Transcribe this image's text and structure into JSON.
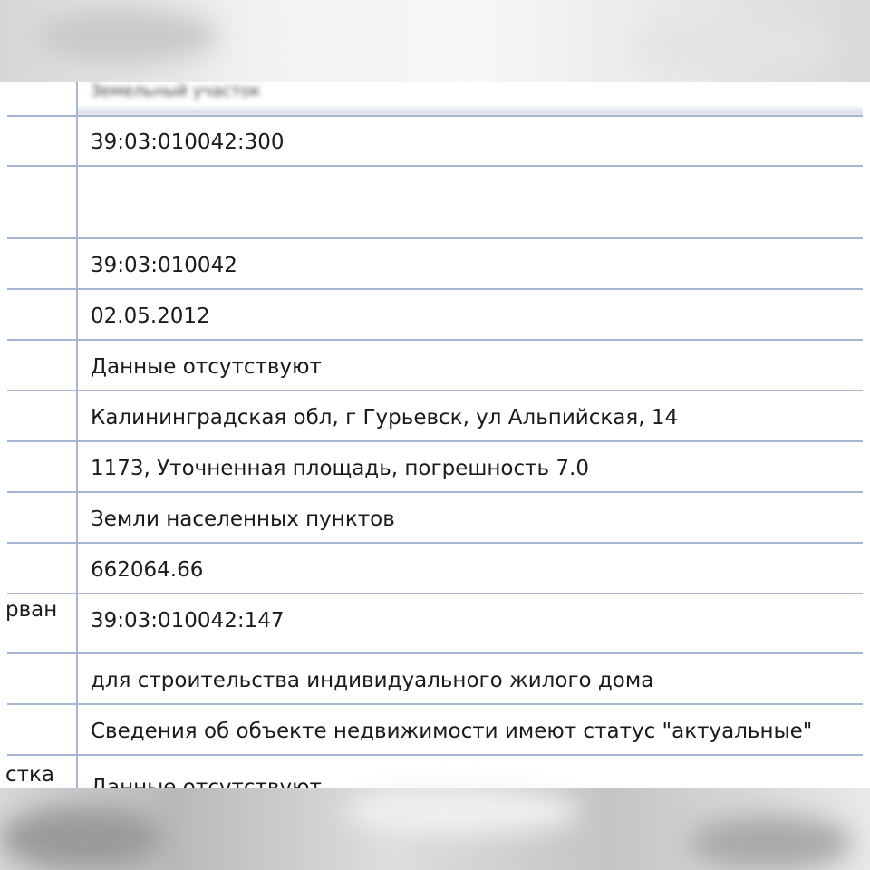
{
  "header": {
    "blurred_label": "Земельный участок"
  },
  "rows": [
    {
      "value": "39:03:010042:300"
    },
    {
      "value": "39:03:010042"
    },
    {
      "value": "02.05.2012"
    },
    {
      "value": "Данные отсутствуют"
    },
    {
      "value": "Калининградская обл, г Гурьевск, ул Альпийская, 14"
    },
    {
      "value": "1173, Уточненная площадь, погрешность 7.0"
    },
    {
      "value": "Земли населенных пунктов"
    },
    {
      "value": "662064.66"
    },
    {
      "value": "39:03:010042:147"
    },
    {
      "value": "для строительства индивидуального жилого дома"
    },
    {
      "value": "Сведения об объекте недвижимости имеют статус \"актуальные\""
    },
    {
      "value": "Данные отсутствуют"
    }
  ],
  "left_labels": {
    "row9": "рван",
    "row12": "стка"
  }
}
